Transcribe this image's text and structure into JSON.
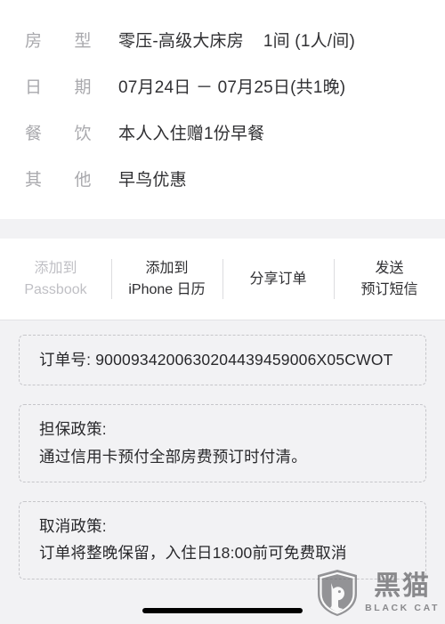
{
  "detail_list": {
    "rows": [
      {
        "label_chars": [
          "房",
          "型"
        ],
        "value": "零压-高级大床房    1间 (1人/间)"
      },
      {
        "label_chars": [
          "日",
          "期"
        ],
        "value": "07月24日 － 07月25日(共1晚)"
      },
      {
        "label_chars": [
          "餐",
          "饮"
        ],
        "value": "本人入住赠1份早餐"
      },
      {
        "label_chars": [
          "其",
          "他"
        ],
        "value": "早鸟优惠"
      }
    ]
  },
  "action_bar": {
    "buttons": [
      {
        "line1": "添加到",
        "line2": "Passbook",
        "state": "disabled",
        "name": "add-to-passbook-button"
      },
      {
        "line1": "添加到",
        "line2": "iPhone 日历",
        "state": "enabled",
        "name": "add-to-iphone-calendar-button"
      },
      {
        "line1": "分享订单",
        "line2": "",
        "state": "enabled",
        "name": "share-order-button"
      },
      {
        "line1": "发送",
        "line2": "预订短信",
        "state": "enabled",
        "name": "send-booking-sms-button"
      }
    ]
  },
  "cards": [
    {
      "name": "order-number-card",
      "title": "",
      "lines": [
        "订单号: 9000934200630204439459006X05CWOT"
      ]
    },
    {
      "name": "guarantee-policy-card",
      "title": "担保政策:",
      "lines": [
        "通过信用卡预付全部房费预订时付清。"
      ]
    },
    {
      "name": "cancellation-policy-card",
      "title": "取消政策:",
      "lines": [
        "订单将整晚保留，入住日18:00前可免费取消"
      ]
    }
  ],
  "watermark": {
    "cn_text": "黑猫",
    "en_text": "BLACK CAT",
    "icon": "shield-cat-icon"
  },
  "colors": {
    "page_background": "#f2f2f4",
    "panel_background": "#ffffff",
    "label_text": "#a9a9ad",
    "value_text": "#303033",
    "disabled_text": "#bfbfc4",
    "dashed_border": "#c6c6ca",
    "home_indicator": "#000000"
  }
}
